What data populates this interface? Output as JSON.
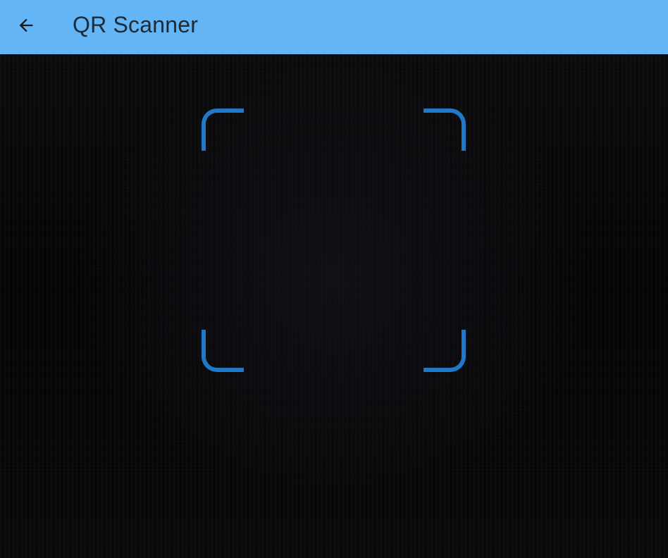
{
  "app_bar": {
    "title": "QR Scanner",
    "back_icon": "arrow-left-icon",
    "background_color": "#63b5f6"
  },
  "scanner": {
    "frame_color": "#1f78c8",
    "corner_icons": [
      "corner-top-left",
      "corner-top-right",
      "corner-bottom-left",
      "corner-bottom-right"
    ]
  }
}
